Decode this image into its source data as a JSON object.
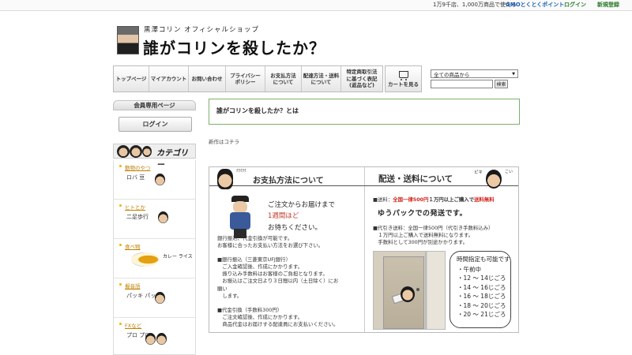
{
  "topbar": {
    "promo": "1万9千店、1,000万商品で使える",
    "gmo_label": "GMOとくとくポイント",
    "login_link": "ログイン",
    "register_link": "新規登録"
  },
  "header": {
    "subtitle": "黒澤コリン オフィシャルショップ",
    "title": "誰がコリンを殺したか？"
  },
  "nav": {
    "items": [
      {
        "label": "トップページ"
      },
      {
        "label": "マイアカウント"
      },
      {
        "label": "お問い合わせ"
      },
      {
        "label": "プライバシー\nポリシー"
      },
      {
        "label": "お支払方法\nについて"
      },
      {
        "label": "配達方法・送料\nについて"
      },
      {
        "label": "特定商取引法\nに基づく表記\n(返品など)"
      }
    ],
    "cart_label": "カートを見る"
  },
  "search": {
    "category_selected": "全ての商品から",
    "query": "",
    "button_label": "検索"
  },
  "sidebar": {
    "member_heading": "会員専用ページ",
    "login_button": "ログイン",
    "category_banner": "カテゴリー",
    "categories": [
      {
        "name": "動物のやつ",
        "caption": "ロバ 豆"
      },
      {
        "name": "ヒトとか",
        "caption": "二足歩行"
      },
      {
        "name": "食べ物",
        "caption": "カレー ライス"
      },
      {
        "name": "擬音語",
        "caption": "パッキ パッキ"
      },
      {
        "name": "FXなど",
        "caption": "プロ プロ"
      }
    ]
  },
  "main": {
    "info_title": "誰がコリンを殺したか？とは",
    "new_link": "新作はコチラ",
    "payment": {
      "heading": "お支払方法について",
      "sound_note": "ｸｸｸｸｸ",
      "hand_note_l1": "ご注文からお届けまで",
      "hand_note_l2": "1週間ほど",
      "hand_note_l3": "お待ちください。",
      "paragraphs": [
        "銀行振込、代金引換が可能です。\nお客様に合ったお支払い方法をお選び下さい。",
        "■銀行振込（三菱東京UFJ銀行）\n　ご入金確認後、作成にかかります。\n　振り込み手数料はお客様のご負担となります。\n　お振込はご注文日より３日間以内（土日除く）にお\n願い\n　します。",
        "■代金引換（手数料300円）\n　ご注文確認後、作成にかかります。\n　商品代金はお届けする配達員にお支払いください。"
      ]
    },
    "shipping": {
      "heading": "配送・送料について",
      "sound_note_1": "ピキ",
      "sound_note_2": "こい",
      "line1_prefix": "■送料：",
      "line1_red": "全国一律500円",
      "line1_mid": "１万円以上ご購入で",
      "line1_red2": "送料無料",
      "yu_pack": "ゆうパックでの発送です。",
      "cod_text": "■代引き送料：全国一律500円（代引き手数料込み）\n　１万円以上ご購入で送料無料になります。\n　手数料として300円が別途かかります。",
      "time_title": "時間指定も可能です",
      "time_slots": [
        "・午前中",
        "・12 〜 14じごろ",
        "・14 〜 16じごろ",
        "・16 〜 18じごろ",
        "・18 〜 20じごろ",
        "・20 〜 21じごろ"
      ]
    }
  }
}
